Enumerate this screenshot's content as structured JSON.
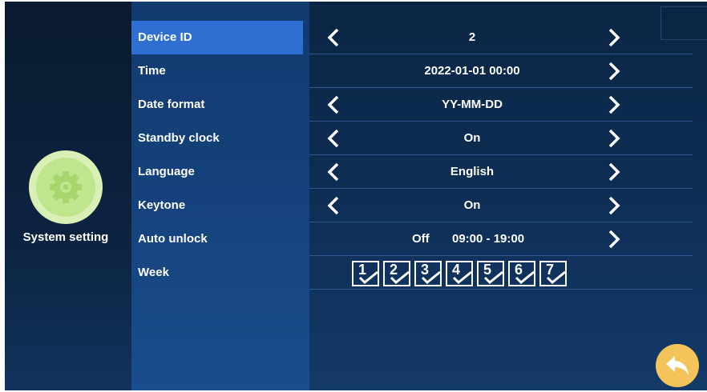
{
  "sidebar": {
    "title": "System setting",
    "icon": "gear-icon"
  },
  "settings": [
    {
      "label": "Device ID",
      "value": "2",
      "has_left": true,
      "has_right": true,
      "selected": true
    },
    {
      "label": "Time",
      "value": "2022-01-01  00:00",
      "has_left": false,
      "has_right": true,
      "selected": false
    },
    {
      "label": "Date format",
      "value": "YY-MM-DD",
      "has_left": true,
      "has_right": true,
      "selected": false
    },
    {
      "label": "Standby clock",
      "value": "On",
      "has_left": true,
      "has_right": true,
      "selected": false
    },
    {
      "label": "Language",
      "value": "English",
      "has_left": true,
      "has_right": true,
      "selected": false
    },
    {
      "label": "Keytone",
      "value": "On",
      "has_left": true,
      "has_right": true,
      "selected": false
    }
  ],
  "auto_unlock": {
    "label": "Auto unlock",
    "state": "Off",
    "time": "09:00 - 19:00"
  },
  "week": {
    "label": "Week",
    "days": [
      "1",
      "2",
      "3",
      "4",
      "5",
      "6",
      "7"
    ]
  },
  "colors": {
    "selected_row": "#2f6fd1",
    "back_button": "#f4c35a",
    "icon_bg": "#d8f0b5"
  }
}
